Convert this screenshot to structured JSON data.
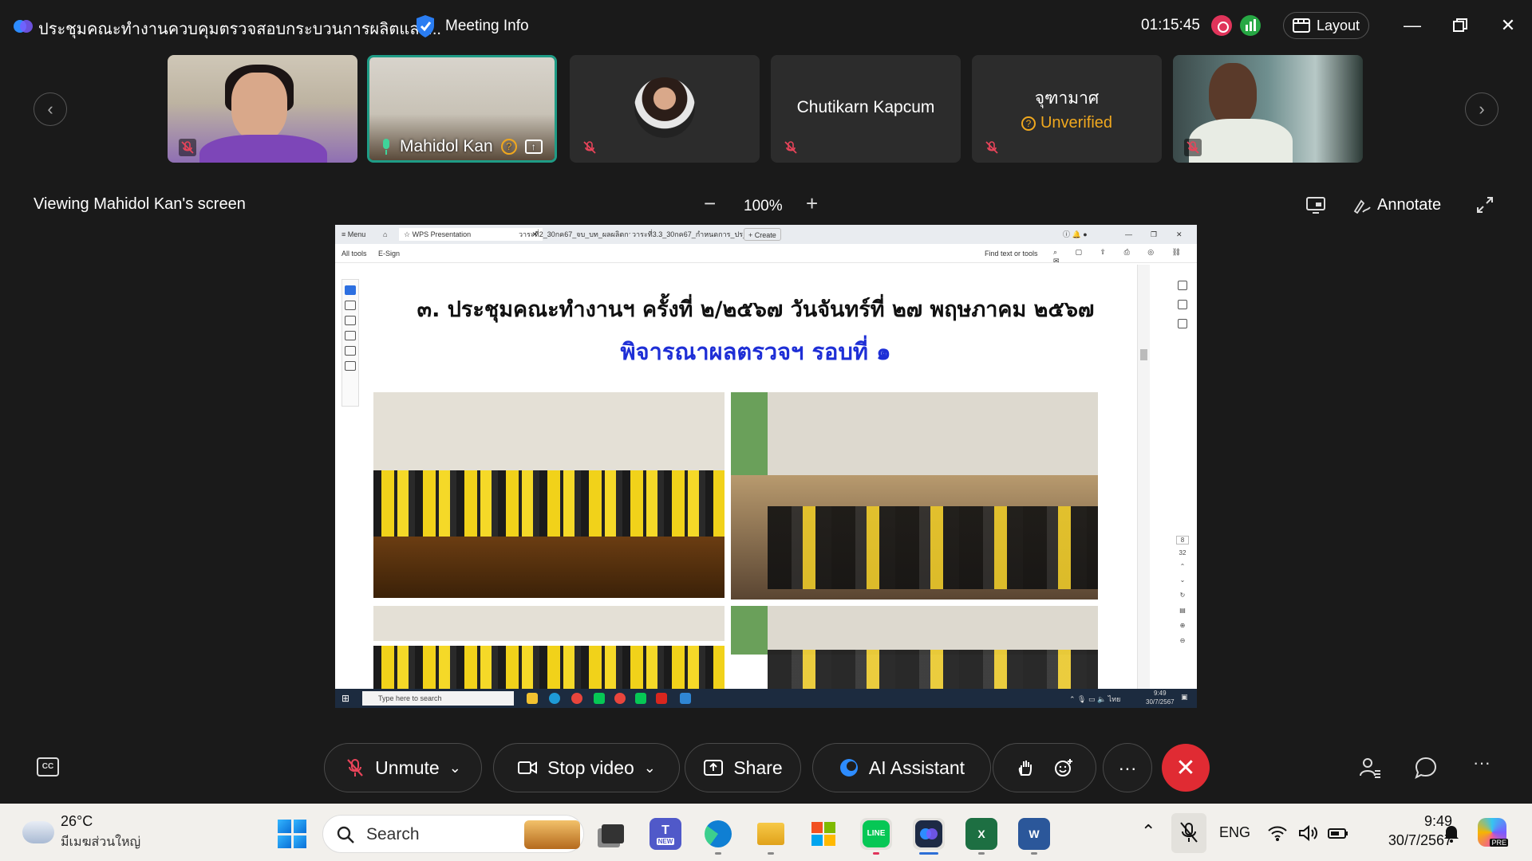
{
  "window": {
    "meeting_title": "ประชุมคณะทำงานควบคุมตรวจสอบกระบวนการผลิตและ...",
    "meeting_info_label": "Meeting Info",
    "elapsed_time": "01:15:45",
    "layout_label": "Layout"
  },
  "gallery": {
    "tiles": [
      {
        "name": "",
        "muted": true
      },
      {
        "name": "Mahidol Kan",
        "muted": false,
        "active": true
      },
      {
        "name": "",
        "muted": true
      },
      {
        "name": "Chutikarn Kapcum",
        "muted": true
      },
      {
        "name": "จุฑามาศ",
        "status": "Unverified",
        "muted": true
      },
      {
        "name": "",
        "muted": true
      }
    ]
  },
  "viewer": {
    "viewing_label": "Viewing Mahidol Kan's screen",
    "zoom_minus": "−",
    "zoom_level": "100%",
    "zoom_plus": "+",
    "annotate_label": "Annotate"
  },
  "shared_screen": {
    "tabs": {
      "menu": "Menu",
      "tab1": "WPS Presentation",
      "tab2": "วาระที่2_30กค67_จบ_บท_ผลผลิตกานนิม...",
      "tab3": "วาระที่3.3_30กค67_กำหนดการ_ปร_ตาก...",
      "create": "+ Create"
    },
    "toolbar": {
      "all_tools": "All tools",
      "esign": "E-Sign",
      "find": "Find text or tools"
    },
    "slide": {
      "heading": "๓. ประชุมคณะทำงานฯ ครั้งที่ ๒/๒๕๖๗  วันจันทร์ที่ ๒๗ พฤษภาคม ๒๕๖๗",
      "subheading": "พิจารณาผลตรวจฯ รอบที่ ๑"
    },
    "page_indicator": {
      "current": "8",
      "total": "32"
    },
    "inner_taskbar": {
      "search": "Type here to search",
      "time": "9:49",
      "date": "30/7/2567"
    }
  },
  "controls": {
    "unmute": "Unmute",
    "stop_video": "Stop video",
    "share": "Share",
    "ai_assistant": "AI Assistant",
    "more": "···",
    "end": "✕",
    "more_right": "···"
  },
  "taskbar": {
    "temperature": "26°C",
    "weather_desc": "มีเมฆส่วนใหญ่",
    "search_label": "Search",
    "language": "ENG",
    "time": "9:49",
    "date": "30/7/2567",
    "teams_badge": "NEW",
    "line_label": "LINE",
    "copilot_badge": "PRE"
  },
  "colors": {
    "accent": "#1f9c86",
    "end_call": "#e02b33",
    "unverified": "#f0a81e",
    "slide_sub": "#1e2fd6"
  }
}
